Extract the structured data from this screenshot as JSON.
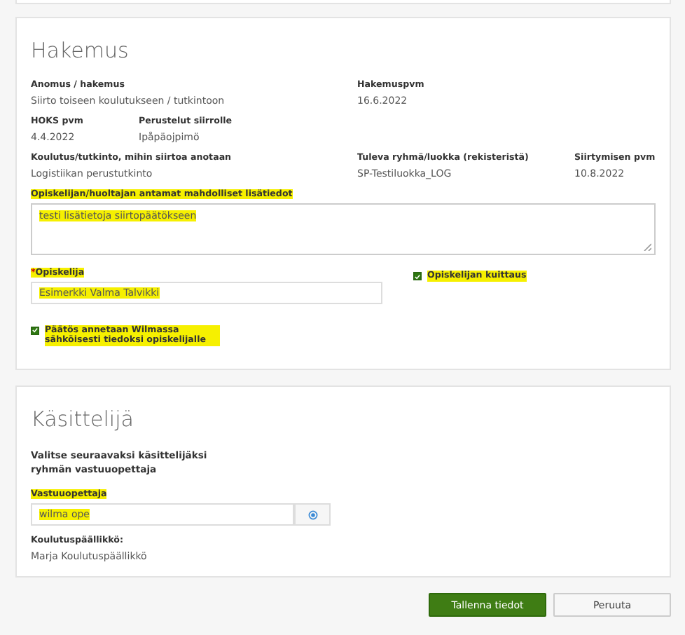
{
  "application": {
    "title": "Hakemus",
    "request": {
      "label": "Anomus / hakemus",
      "value": "Siirto toiseen koulutukseen / tutkintoon"
    },
    "request_date": {
      "label": "Hakemuspvm",
      "value": "16.6.2022"
    },
    "hoks_date": {
      "label": "HOKS pvm",
      "value": "4.4.2022"
    },
    "reasons": {
      "label": "Perustelut siirrolle",
      "value": "Ipåpäojpimö"
    },
    "target_education": {
      "label": "Koulutus/tutkinto, mihin siirtoa anotaan",
      "value": "Logistiikan perustutkinto"
    },
    "future_group": {
      "label": "Tuleva ryhmä/luokka (rekisteristä)",
      "value": "SP-Testiluokka_LOG"
    },
    "transfer_date": {
      "label": "Siirtymisen pvm",
      "value": "10.8.2022"
    },
    "notes": {
      "label": "Opiskelijan/huoltajan antamat mahdolliset lisätiedot",
      "value": "testi lisätietoja siirtopäätökseen",
      "highlighted": true
    },
    "student": {
      "required_mark": "*",
      "label": "Opiskelija",
      "value": "Esimerkki Valma Talvikki",
      "highlighted": true
    },
    "acknowledged": {
      "label": "Opiskelijan kuittaus",
      "checked": true,
      "highlighted": true
    },
    "wilma_notice": {
      "label": "Päätös annetaan Wilmassa sähköisesti tiedoksi opiskelijalle",
      "checked": true,
      "highlighted": true
    }
  },
  "handler": {
    "title": "Käsittelijä",
    "instruction": "Valitse seuraavaksi käsittelijäksi ryhmän vastuuopettaja",
    "teacher": {
      "label": "Vastuuopettaja",
      "value": "wilma ope",
      "highlighted": true
    },
    "manager": {
      "label": "Koulutuspäällikkö:",
      "value": "Marja Koulutuspäällikkö"
    }
  },
  "buttons": [
    {
      "label": "Tallenna tiedot",
      "kind": "primary"
    },
    {
      "label": "Peruuta",
      "kind": "secondary"
    }
  ]
}
